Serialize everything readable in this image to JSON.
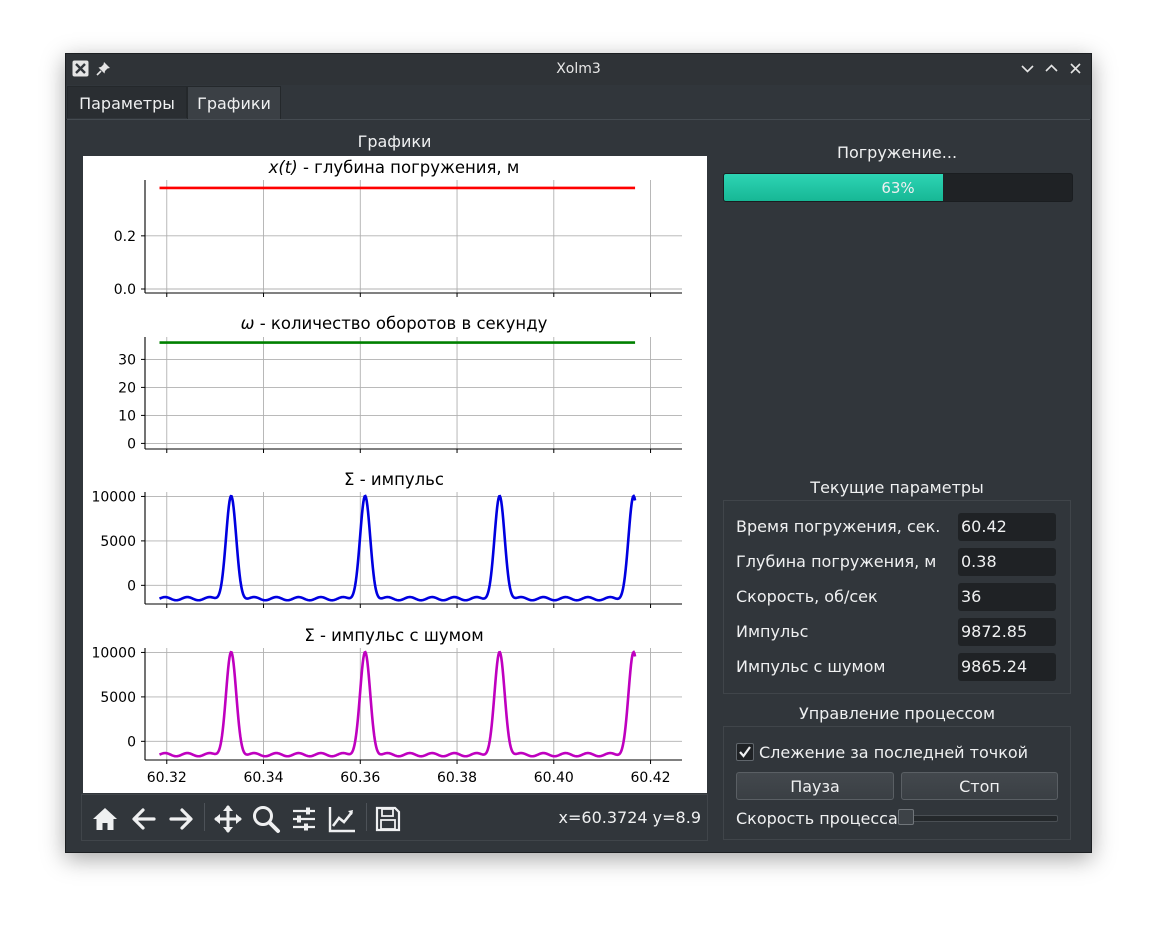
{
  "window": {
    "title": "Xolm3"
  },
  "tabs": [
    {
      "label": "Параметры",
      "active": false
    },
    {
      "label": "Графики",
      "active": true
    }
  ],
  "graphs_group": {
    "label": "Графики"
  },
  "plots": {
    "x_ticks": [
      "60.32",
      "60.34",
      "60.36",
      "60.38",
      "60.40",
      "60.42"
    ],
    "subplot1": {
      "title": "x(t) - глубина погружения, м",
      "title_var": "x(t)",
      "title_rest": " - глубина погружения, м",
      "y_ticks": [
        "0.2",
        "0.0"
      ],
      "color": "#ff0000"
    },
    "subplot2": {
      "title": "ω - количество оборотов в секунду",
      "title_var": "ω",
      "title_rest": " - количество оборотов в секунду",
      "y_ticks": [
        "30",
        "20",
        "10",
        "0"
      ],
      "color": "#008000"
    },
    "subplot3": {
      "title": "Σ - импульс",
      "y_ticks": [
        "10000",
        "5000",
        "0"
      ],
      "color": "#0000e0"
    },
    "subplot4": {
      "title": "Σ - импульс с шумом",
      "y_ticks": [
        "10000",
        "5000",
        "0"
      ],
      "color": "#bf00bf"
    }
  },
  "chart_data": [
    {
      "type": "line",
      "title": "x(t) - глубина погружения, м",
      "x": [
        60.3185,
        60.4168
      ],
      "series": [
        {
          "values": [
            0.38,
            0.38
          ]
        }
      ],
      "xlim": [
        60.3155,
        60.4265
      ],
      "ylim": [
        -0.015,
        0.41
      ]
    },
    {
      "type": "line",
      "title": "ω - количество оборотов в секунду",
      "x": [
        60.3185,
        60.4168
      ],
      "series": [
        {
          "values": [
            36,
            36
          ]
        }
      ],
      "xlim": [
        60.3155,
        60.4265
      ],
      "ylim": [
        -2,
        38
      ]
    },
    {
      "type": "line",
      "title": "Σ - импульс",
      "x_range": [
        60.3185,
        60.4168
      ],
      "peaks": [
        60.3333,
        60.361,
        60.3888,
        60.4165
      ],
      "peak_value": 9872.85,
      "baseline": -1500,
      "xlim": [
        60.3155,
        60.4265
      ],
      "ylim": [
        -2100,
        10500
      ]
    },
    {
      "type": "line",
      "title": "Σ - импульс с шумом",
      "x_range": [
        60.3185,
        60.4168
      ],
      "peaks": [
        60.3333,
        60.361,
        60.3888,
        60.4165
      ],
      "peak_value": 9865.24,
      "baseline": -1500,
      "xlim": [
        60.3155,
        60.4265
      ],
      "ylim": [
        -2100,
        10500
      ]
    }
  ],
  "toolbar": {
    "icons": [
      "home-icon",
      "back-arrow-icon",
      "forward-arrow-icon",
      "pan-icon",
      "zoom-icon",
      "configure-subplots-icon",
      "edit-axis-icon",
      "save-icon"
    ],
    "coords": "x=60.3724 y=8.9"
  },
  "status": {
    "label": "Погружение..."
  },
  "progress": {
    "percent": 63,
    "text": "63%"
  },
  "params": {
    "title": "Текущие параметры",
    "rows": [
      {
        "label": "Время погружения, сек.",
        "value": "60.42"
      },
      {
        "label": "Глубина погружения, м",
        "value": "0.38"
      },
      {
        "label": "Скорость, об/сек",
        "value": "36"
      },
      {
        "label": "Импульс",
        "value": "9872.85"
      },
      {
        "label": "Импульс с шумом",
        "value": "9865.24"
      }
    ]
  },
  "control": {
    "title": "Управление процессом",
    "follow_label": "Слежение за последней точкой",
    "follow_checked": true,
    "pause_label": "Пауза",
    "stop_label": "Стоп",
    "speed_label": "Скорость процесса",
    "speed_value": 0
  }
}
